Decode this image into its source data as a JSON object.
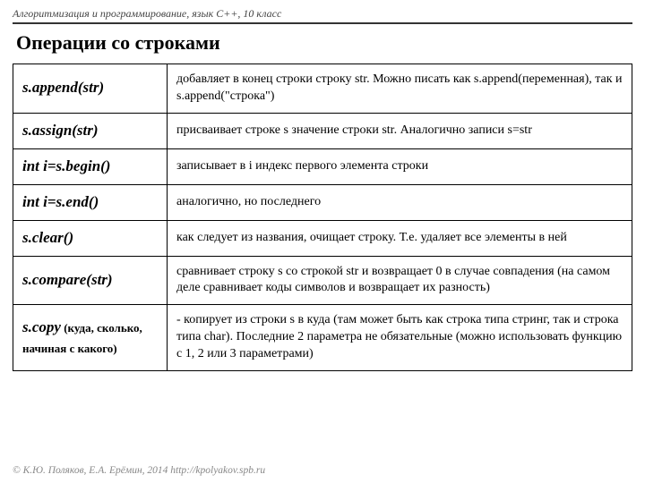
{
  "header": "Алгоритмизация и программирование, язык C++, 10 класс",
  "title": "Операции со строками",
  "rows": [
    {
      "method": "s.append(str)",
      "desc": "добавляет в конец строки строку str. Можно писать как s.append(переменная), так и s.append(\"строка\")"
    },
    {
      "method": "s.assign(str)",
      "desc": "присваивает строке s значение строки str. Аналогично записи s=str"
    },
    {
      "method": "int i=s.begin()",
      "desc": "записывает в i индекс первого элемента строки"
    },
    {
      "method": "int i=s.end()",
      "desc": "аналогично, но последнего"
    },
    {
      "method": "s.clear()",
      "desc": "как следует из названия, очищает строку. Т.е. удаляет все элементы в ней"
    },
    {
      "method": "s.compare(str)",
      "desc": "сравнивает строку s со строкой str и возвращает 0 в случае совпадения (на самом деле сравнивает коды символов и возвращает их разность)"
    },
    {
      "method": "s.copy",
      "method_sub": " (куда, сколько, начиная с какого)",
      "desc": "- копирует из строки s в куда (там может быть как строка типа стринг, так и строка типа char). Последние 2 параметра не обязательные (можно использовать функцию с 1, 2 или 3 параметрами)"
    }
  ],
  "footer": "© К.Ю. Поляков, Е.А. Ерёмин, 2014   http://kpolyakov.spb.ru"
}
